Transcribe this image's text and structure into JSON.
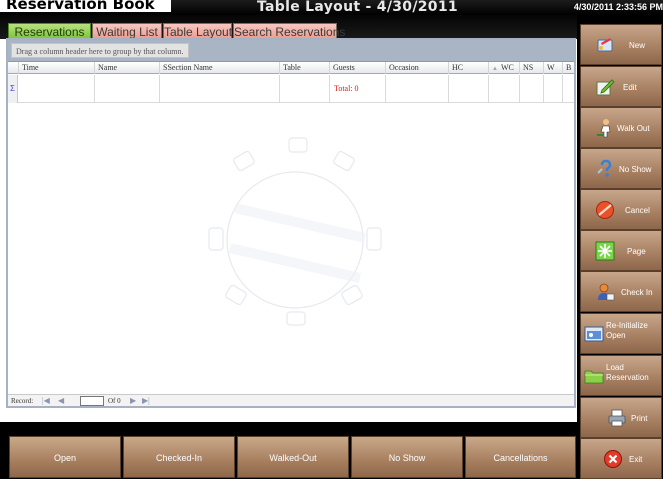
{
  "app": {
    "title": "Reservation Book",
    "window_title": "Table Layout - 4/30/2011",
    "datetime": "4/30/2011 2:33:56 PM"
  },
  "tabs": [
    {
      "label": "Reservations",
      "active": true
    },
    {
      "label": "Waiting List",
      "active": false
    },
    {
      "label": "Table Layout",
      "active": false
    },
    {
      "label": "Search Reservations",
      "active": false
    }
  ],
  "grid": {
    "group_hint": "Drag a column header here to group by that column.",
    "columns": [
      "Time",
      "Name",
      "SSection Name",
      "Table",
      "Guests",
      "Occasion",
      "HC",
      "WC",
      "NS",
      "W",
      "B"
    ],
    "row_indicator": "Σ",
    "total_label": "Total: 0"
  },
  "navigator": {
    "record_label": "Record:",
    "first_btn": "|◀",
    "prev_btn": "◀",
    "current": "",
    "of_label": "Of 0",
    "next_btn": "▶",
    "last_btn": "▶|"
  },
  "bottom_buttons": [
    {
      "label": "Open"
    },
    {
      "label": "Checked-In"
    },
    {
      "label": "Walked-Out"
    },
    {
      "label": "No Show"
    },
    {
      "label": "Cancellations"
    }
  ],
  "sidebar_buttons": [
    {
      "label": "New",
      "icon": "new-icon"
    },
    {
      "label": "Edit",
      "icon": "edit-icon"
    },
    {
      "label": "Walk Out",
      "icon": "walk-out-icon"
    },
    {
      "label": "No Show",
      "icon": "no-show-icon"
    },
    {
      "label": "Cancel",
      "icon": "cancel-icon"
    },
    {
      "label": "Page",
      "icon": "page-icon"
    },
    {
      "label": "Check In",
      "icon": "check-in-icon"
    },
    {
      "label": "Re-Initialize Open",
      "icon": "re-initialize-icon"
    },
    {
      "label": "Load Reservation",
      "icon": "load-reservation-icon"
    },
    {
      "label": "Print",
      "icon": "print-icon"
    },
    {
      "label": "Exit",
      "icon": "exit-icon"
    }
  ],
  "colors": {
    "active_tab": "#7cc43a",
    "inactive_tab": "#ec9a8e",
    "button_brown": "#a67e60",
    "total_text": "#d02020"
  }
}
